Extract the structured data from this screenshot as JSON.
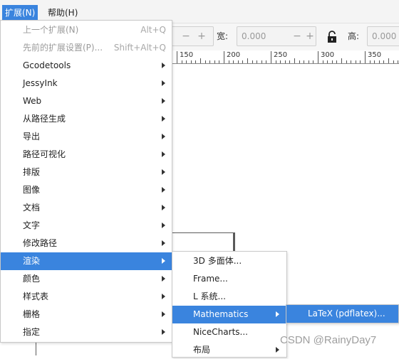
{
  "menubar": {
    "items": [
      {
        "label": "扩展(N)",
        "active": true
      },
      {
        "label": "帮助(H)",
        "active": false
      }
    ]
  },
  "toolbar": {
    "w_label": "宽:",
    "w_value": "0.000",
    "h_label": "高:",
    "h_value": "0.000",
    "minus": "−",
    "plus": "+"
  },
  "ruler": {
    "labels": [
      "150",
      "200",
      "250",
      "300",
      "350"
    ]
  },
  "main_menu": {
    "items": [
      {
        "label": "上一个扩展(N)",
        "shortcut": "Alt+Q",
        "disabled": true
      },
      {
        "label": "先前的扩展设置(P)...",
        "shortcut": "Shift+Alt+Q",
        "disabled": true
      },
      {
        "label": "Gcodetools",
        "submenu": true
      },
      {
        "label": "JessyInk",
        "submenu": true
      },
      {
        "label": "Web",
        "submenu": true
      },
      {
        "label": "从路径生成",
        "submenu": true
      },
      {
        "label": "导出",
        "submenu": true
      },
      {
        "label": "路径可视化",
        "submenu": true
      },
      {
        "label": "排版",
        "submenu": true
      },
      {
        "label": "图像",
        "submenu": true
      },
      {
        "label": "文档",
        "submenu": true
      },
      {
        "label": "文字",
        "submenu": true
      },
      {
        "label": "修改路径",
        "submenu": true
      },
      {
        "label": "渲染",
        "submenu": true,
        "highlighted": true
      },
      {
        "label": "颜色",
        "submenu": true
      },
      {
        "label": "样式表",
        "submenu": true
      },
      {
        "label": "栅格",
        "submenu": true
      },
      {
        "label": "指定",
        "submenu": true
      }
    ]
  },
  "render_menu": {
    "items": [
      {
        "label": "3D 多面体..."
      },
      {
        "label": "Frame..."
      },
      {
        "label": "L 系统..."
      },
      {
        "label": "Mathematics",
        "submenu": true,
        "highlighted": true
      },
      {
        "label": "NiceCharts..."
      },
      {
        "label": "布局",
        "submenu": true
      }
    ]
  },
  "math_menu": {
    "items": [
      {
        "label": "LaTeX (pdflatex)...",
        "highlighted": true
      }
    ]
  },
  "watermark": "CSDN @RainyDay7",
  "colors": {
    "highlight": "#3a84de",
    "disabled_text": "#9b9b9b"
  }
}
